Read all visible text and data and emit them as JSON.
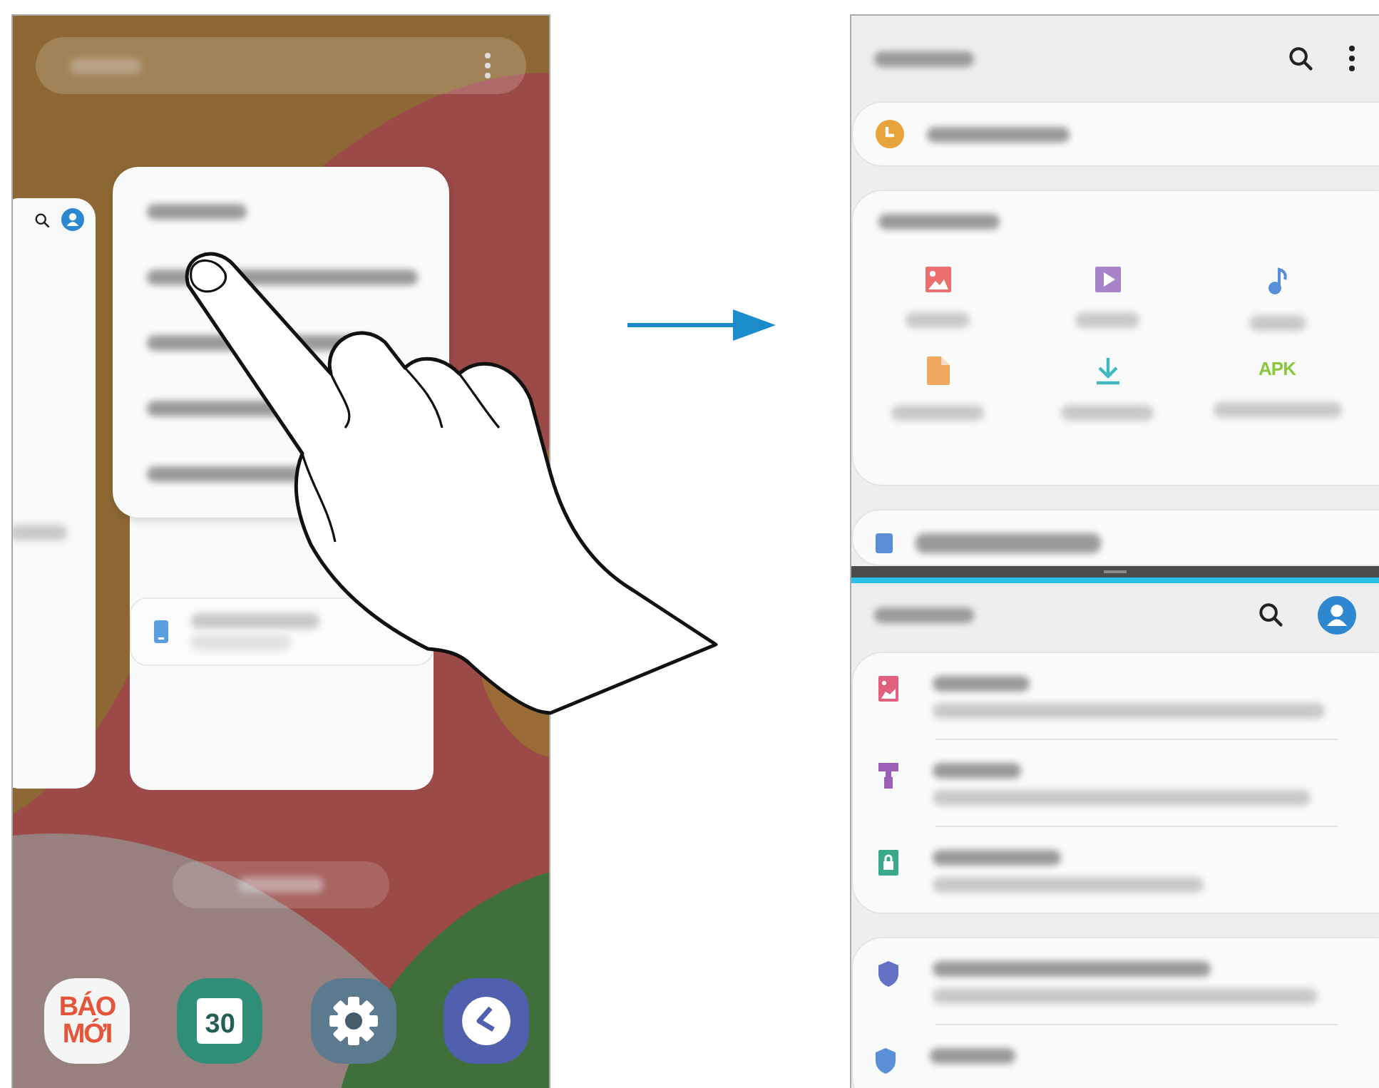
{
  "left_screen": {
    "dock_apps": [
      {
        "kind": "news",
        "label_lines": [
          "BÁO",
          "MỚI"
        ]
      },
      {
        "kind": "calendar",
        "label": "30"
      },
      {
        "kind": "settings"
      },
      {
        "kind": "clock"
      }
    ]
  },
  "right_screen": {
    "file_categories": [
      {
        "kind": "images"
      },
      {
        "kind": "videos"
      },
      {
        "kind": "audio"
      },
      {
        "kind": "documents"
      },
      {
        "kind": "downloads"
      },
      {
        "kind": "apk",
        "label": "APK"
      }
    ]
  }
}
